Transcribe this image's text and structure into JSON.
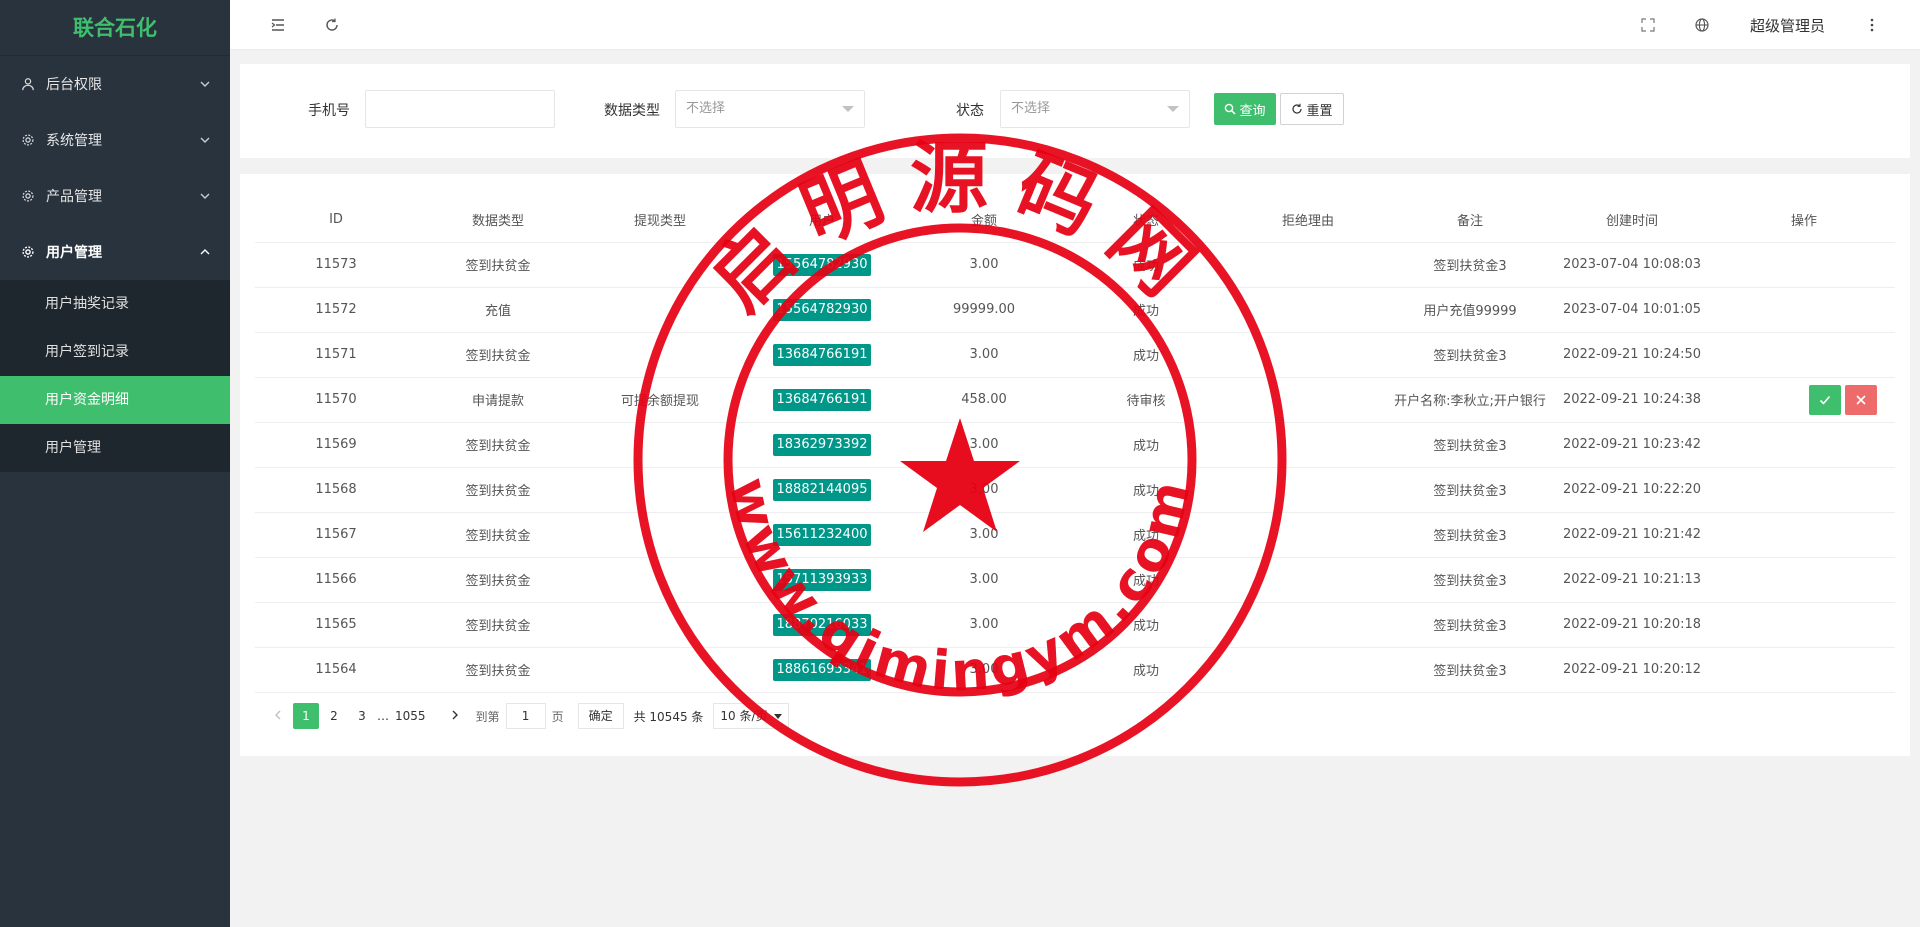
{
  "app": {
    "logo": "联合石化"
  },
  "sidebar": {
    "items": [
      {
        "label": "后台权限",
        "icon": "user-icon"
      },
      {
        "label": "系统管理",
        "icon": "gear-icon"
      },
      {
        "label": "产品管理",
        "icon": "gear-icon"
      },
      {
        "label": "用户管理",
        "icon": "gear-icon"
      }
    ],
    "subitems": [
      {
        "label": "用户抽奖记录"
      },
      {
        "label": "用户签到记录"
      },
      {
        "label": "用户资金明细"
      },
      {
        "label": "用户管理"
      }
    ]
  },
  "header": {
    "admin": "超级管理员"
  },
  "search": {
    "phone_label": "手机号",
    "phone_value": "",
    "type_label": "数据类型",
    "type_placeholder": "不选择",
    "status_label": "状态",
    "status_placeholder": "不选择",
    "query_label": "查询",
    "reset_label": "重置"
  },
  "table": {
    "columns": [
      "ID",
      "数据类型",
      "提现类型",
      "用户",
      "金额",
      "状态",
      "拒绝理由",
      "备注",
      "创建时间",
      "操作"
    ],
    "rows": [
      {
        "id": "11573",
        "type": "签到扶贫金",
        "wtype": "",
        "user": "15564782930",
        "amount": "3.00",
        "status": "成功",
        "reason": "",
        "remark": "签到扶贫金3",
        "time": "2023-07-04 10:08:03"
      },
      {
        "id": "11572",
        "type": "充值",
        "wtype": "",
        "user": "15564782930",
        "amount": "99999.00",
        "status": "成功",
        "reason": "",
        "remark": "用户充值99999",
        "time": "2023-07-04 10:01:05"
      },
      {
        "id": "11571",
        "type": "签到扶贫金",
        "wtype": "",
        "user": "13684766191",
        "amount": "3.00",
        "status": "成功",
        "reason": "",
        "remark": "签到扶贫金3",
        "time": "2022-09-21 10:24:50"
      },
      {
        "id": "11570",
        "type": "申请提款",
        "wtype": "可提余额提现",
        "user": "13684766191",
        "amount": "458.00",
        "status": "待审核",
        "reason": "",
        "remark": "开户名称:李秋立;开户银行",
        "time": "2022-09-21 10:24:38"
      },
      {
        "id": "11569",
        "type": "签到扶贫金",
        "wtype": "",
        "user": "18362973392",
        "amount": "3.00",
        "status": "成功",
        "reason": "",
        "remark": "签到扶贫金3",
        "time": "2022-09-21 10:23:42"
      },
      {
        "id": "11568",
        "type": "签到扶贫金",
        "wtype": "",
        "user": "18882144095",
        "amount": "3.00",
        "status": "成功",
        "reason": "",
        "remark": "签到扶贫金3",
        "time": "2022-09-21 10:22:20"
      },
      {
        "id": "11567",
        "type": "签到扶贫金",
        "wtype": "",
        "user": "15611232400",
        "amount": "3.00",
        "status": "成功",
        "reason": "",
        "remark": "签到扶贫金3",
        "time": "2022-09-21 10:21:42"
      },
      {
        "id": "11566",
        "type": "签到扶贫金",
        "wtype": "",
        "user": "15711393933",
        "amount": "3.00",
        "status": "成功",
        "reason": "",
        "remark": "签到扶贫金3",
        "time": "2022-09-21 10:21:13"
      },
      {
        "id": "11565",
        "type": "签到扶贫金",
        "wtype": "",
        "user": "18870216033",
        "amount": "3.00",
        "status": "成功",
        "reason": "",
        "remark": "签到扶贫金3",
        "time": "2022-09-21 10:20:18"
      },
      {
        "id": "11564",
        "type": "签到扶贫金",
        "wtype": "",
        "user": "18861695341",
        "amount": "3.00",
        "status": "成功",
        "reason": "",
        "remark": "签到扶贫金3",
        "time": "2022-09-21 10:20:12"
      }
    ]
  },
  "pager": {
    "pages": [
      "1",
      "2",
      "3",
      "…",
      "1055"
    ],
    "goto_label": "到第",
    "goto_value": "1",
    "page_unit": "页",
    "confirm_label": "确定",
    "total_text": "共 10545 条",
    "per_page": "10 条/页"
  },
  "watermark": {
    "top_text": "启明源码网",
    "bottom_text": "www.qimingym.com",
    "color": "#e60012"
  },
  "colors": {
    "accent": "#3fbf6d",
    "sidebar": "#28333e",
    "badge": "#009688",
    "danger": "#ee6b6b"
  }
}
